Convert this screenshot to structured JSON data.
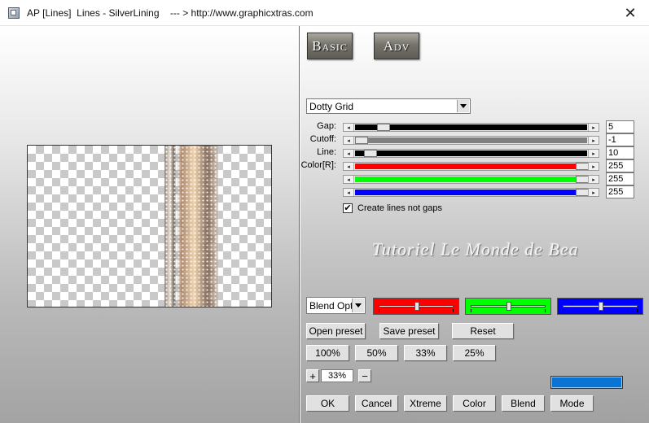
{
  "window": {
    "title": "AP [Lines]  Lines - SilverLining    --- > http://www.graphicxtras.com",
    "close_glyph": "✕"
  },
  "tabs": {
    "basic_label": "Basic",
    "adv_label": "Adv"
  },
  "pattern_select": {
    "value": "Dotty Grid"
  },
  "sliders": [
    {
      "label": "Gap:",
      "value": "5",
      "fill_color": "#000000",
      "thumb_fraction": 0.1
    },
    {
      "label": "Cutoff:",
      "value": "-1",
      "fill_color": "#808080",
      "thumb_fraction": 0.0
    },
    {
      "label": "Line:",
      "value": "10",
      "fill_color": "#000000",
      "thumb_fraction": 0.04
    },
    {
      "label": "Color[R]:",
      "value": "255",
      "fill_color": "#ff0000",
      "thumb_fraction": 1.0
    },
    {
      "label": "",
      "value": "255",
      "fill_color": "#00ff00",
      "thumb_fraction": 1.0
    },
    {
      "label": "",
      "value": "255",
      "fill_color": "#0000ff",
      "thumb_fraction": 1.0
    }
  ],
  "checkbox": {
    "label": "Create lines not gaps",
    "checked": true,
    "check_glyph": "✔"
  },
  "watermark": "Tutoriel Le Monde de Bea",
  "blend_select": {
    "value": "Blend Optio"
  },
  "color_sliders": [
    {
      "color": "#ff0000",
      "fraction": 0.5
    },
    {
      "color": "#00ff00",
      "fraction": 0.5
    },
    {
      "color": "#0000ff",
      "fraction": 0.5
    }
  ],
  "preset_buttons": {
    "open_label": "Open preset",
    "save_label": "Save preset",
    "reset_label": "Reset"
  },
  "zoom_buttons": [
    "100%",
    "50%",
    "33%",
    "25%"
  ],
  "zoom": {
    "plus_label": "+",
    "minus_label": "−",
    "value": "33%"
  },
  "swatch_color": "#0a74d4",
  "bottom_buttons": {
    "ok_label": "OK",
    "cancel_label": "Cancel",
    "xtreme_label": "Xtreme",
    "color_label": "Color",
    "blend_label": "Blend",
    "mode_label": "Mode"
  }
}
